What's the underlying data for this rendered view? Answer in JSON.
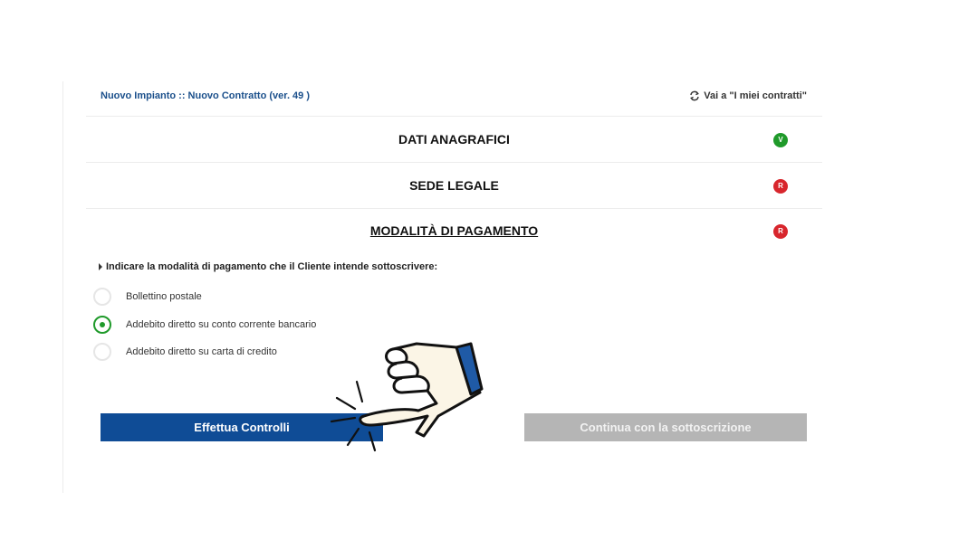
{
  "header": {
    "title": "Nuovo Impianto :: Nuovo Contratto (ver. 49 )",
    "back_link": "Vai a \"I miei contratti\"",
    "back_icon": "refresh-icon"
  },
  "sections": [
    {
      "title": "DATI ANAGRAFICI",
      "badge": "V",
      "status_color": "#1f9a2a"
    },
    {
      "title": "SEDE LEGALE",
      "badge": "R",
      "status_color": "#d8262d"
    },
    {
      "title": "MODALITÀ DI PAGAMENTO",
      "badge": "R",
      "status_color": "#d8262d"
    }
  ],
  "payment": {
    "instruction": "Indicare la modalità di pagamento che il Cliente intende sottoscrivere:",
    "options": [
      {
        "label": "Bollettino postale",
        "selected": false
      },
      {
        "label": "Addebito diretto su conto corrente bancario",
        "selected": true
      },
      {
        "label": "Addebito diretto su carta di credito",
        "selected": false
      }
    ]
  },
  "buttons": {
    "check": "Effettua Controlli",
    "continue": "Continua con la sottoscrizione"
  },
  "overlay": {
    "icon": "pointing-hand-icon"
  },
  "colors": {
    "primary": "#0f4c96",
    "link": "#1a4f8b",
    "success": "#1f9a2a",
    "error": "#d8262d",
    "disabled": "#b5b5b5"
  }
}
